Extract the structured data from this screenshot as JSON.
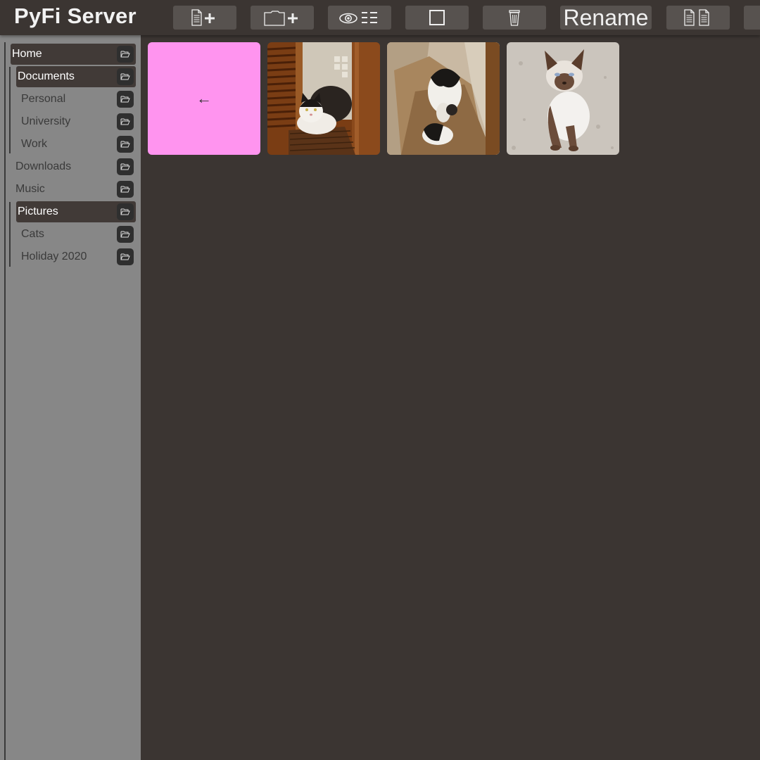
{
  "app": {
    "title": "PyFi Server"
  },
  "toolbar": {
    "new_file_icon": "new-file-icon",
    "new_folder_icon": "new-folder-icon",
    "view_toggle_icon": "view-list-icon",
    "select_icon": "select-box-icon",
    "delete_icon": "trash-icon",
    "rename_label": "Rename",
    "copy_icon": "copy-files-icon"
  },
  "sidebar": {
    "items": [
      {
        "label": "Home",
        "active": true
      },
      {
        "label": "Documents",
        "active": true
      },
      {
        "label": "Personal",
        "active": false
      },
      {
        "label": "University",
        "active": false
      },
      {
        "label": "Work",
        "active": false
      },
      {
        "label": "Downloads",
        "active": false
      },
      {
        "label": "Music",
        "active": false
      },
      {
        "label": "Pictures",
        "active": true
      },
      {
        "label": "Cats",
        "active": false
      },
      {
        "label": "Holiday 2020",
        "active": false
      }
    ]
  },
  "main": {
    "back_tile": {
      "glyph": "←",
      "color": "#ff94ef"
    },
    "thumbnails": [
      {
        "name": "cat-on-basket",
        "subject": "black and white cat on wicker basket"
      },
      {
        "name": "cat-in-bag",
        "subject": "black and white cat curled in paper bag"
      },
      {
        "name": "siamese-cat",
        "subject": "siamese cat sitting on stone floor"
      }
    ]
  },
  "colors": {
    "background": "#3b3532",
    "sidebar": "#878787",
    "active_item": "#413a37",
    "button": "#57524f"
  }
}
